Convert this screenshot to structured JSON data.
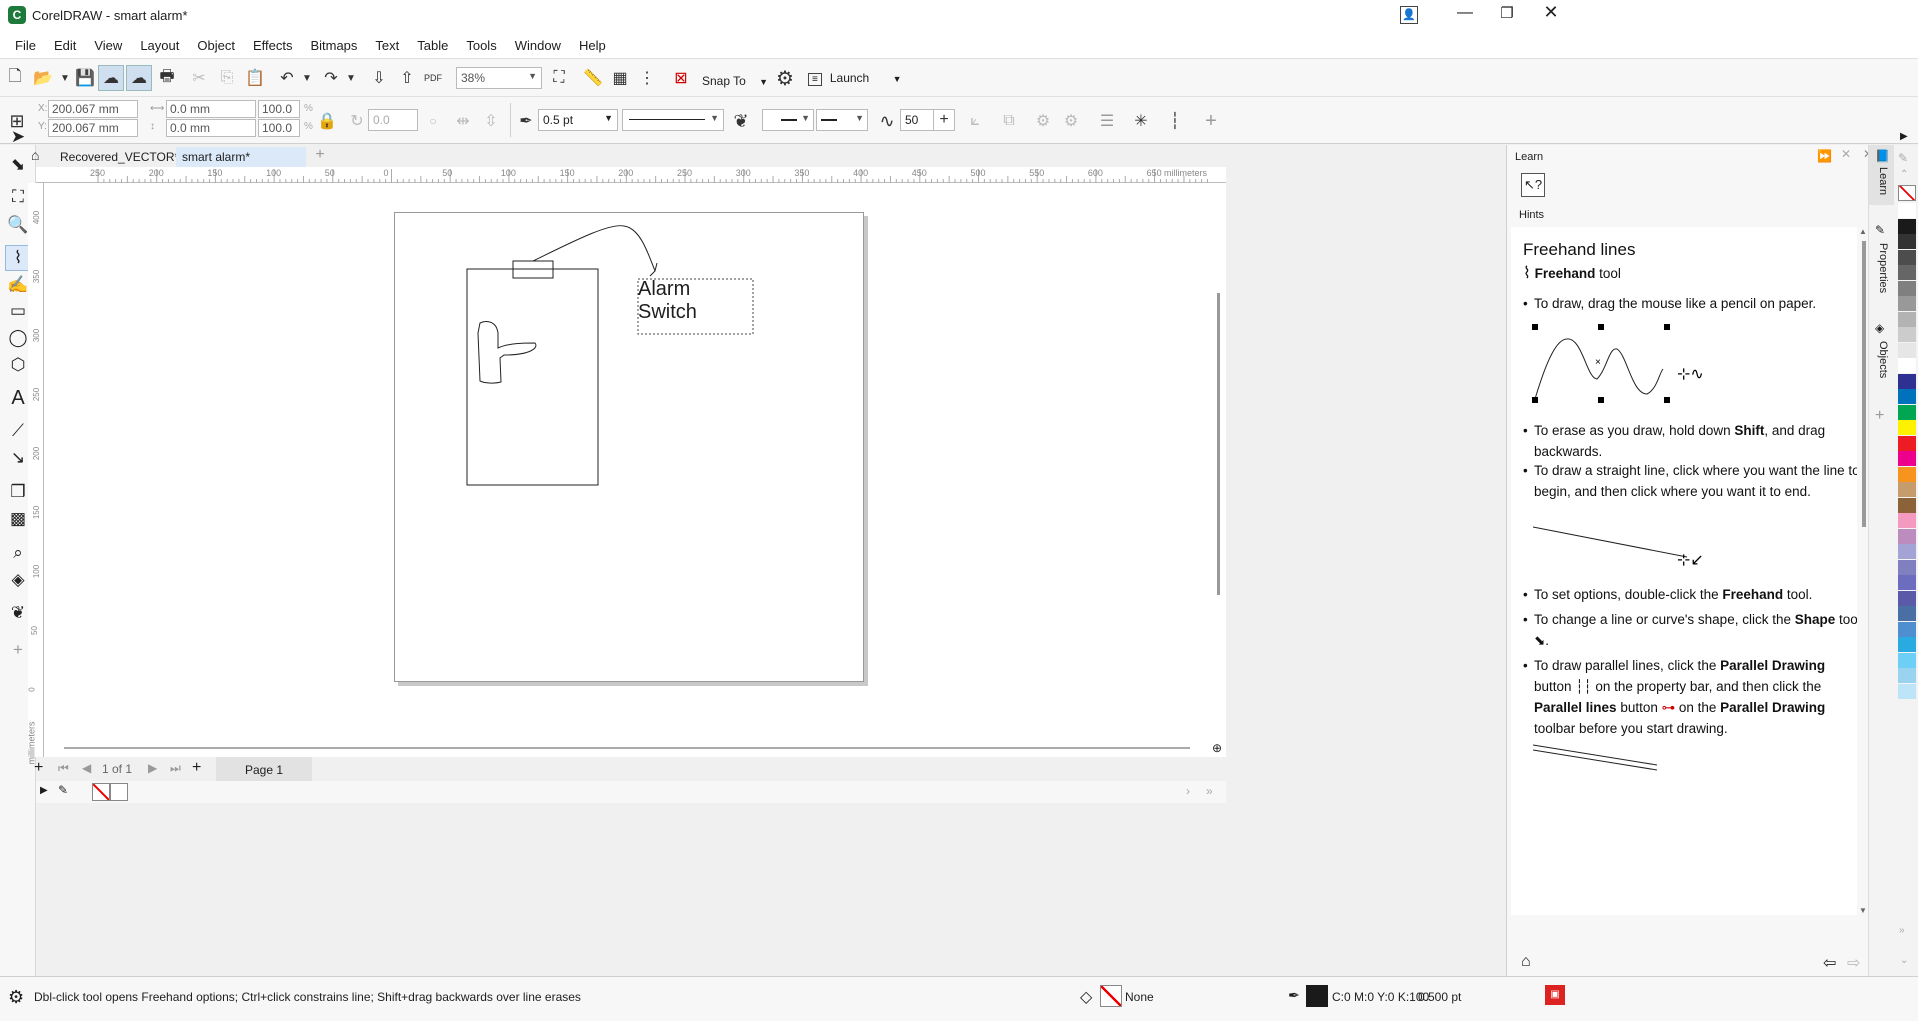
{
  "window": {
    "title": "CorelDRAW - smart alarm*"
  },
  "menu": [
    "File",
    "Edit",
    "View",
    "Layout",
    "Object",
    "Effects",
    "Bitmaps",
    "Text",
    "Table",
    "Tools",
    "Window",
    "Help"
  ],
  "stdbar": {
    "zoom": "38%",
    "snap_label": "Snap To",
    "launch_label": "Launch",
    "pdf_label": "PDF"
  },
  "propbar": {
    "x": "200.067 mm",
    "y": "200.067 mm",
    "w": "0.0 mm",
    "h": "0.0 mm",
    "sx": "100.0",
    "sy": "100.0",
    "pct": "%",
    "rotation": "0.0",
    "outline": "0.5 pt",
    "smoothing": "50",
    "x_label": "X:",
    "y_label": "Y:"
  },
  "doc_tabs": [
    {
      "label": "Recovered_VECTOR*"
    },
    {
      "label": "smart alarm*"
    }
  ],
  "rulers": {
    "h_ticks": [
      "250",
      "200",
      "150",
      "100",
      "50",
      "0",
      "50",
      "100",
      "150",
      "200",
      "250",
      "300",
      "350",
      "400",
      "450",
      "500",
      "550",
      "600",
      "650"
    ],
    "h_unit": "millimeters",
    "v_ticks": [
      "400",
      "350",
      "300",
      "250",
      "200",
      "150",
      "100",
      "50",
      "0"
    ],
    "v_unit": "millimeters"
  },
  "canvas": {
    "text_line1": "Alarm",
    "text_line2": "Switch"
  },
  "pager": {
    "counter": "1 of 1",
    "page_tab": "Page 1"
  },
  "learn": {
    "header": "Learn",
    "hints_label": "Hints",
    "title": "Freehand lines",
    "tool_name": "Freehand",
    "tool_suffix": " tool",
    "b1": "To draw, drag the mouse like a pencil on paper.",
    "b2a": "To erase as you draw, hold down ",
    "b2b": "Shift",
    "b2c": ", and drag backwards.",
    "b3": "To draw a straight line, click where you want the line to begin, and then click where you want it to end.",
    "b4a": "To set options, double-click the ",
    "b4b": "Freehand",
    "b4c": " tool.",
    "b5a": "To change a line or curve's shape, click the ",
    "b5b": "Shape",
    "b5c": " tool",
    "b6a": "To draw parallel lines, click the ",
    "b6b": "Parallel Drawing",
    "b6c": " button",
    "b6d": " on the property bar, and then click the ",
    "b6e": "Parallel lines",
    "b6f": " button ",
    "b6g": " on the ",
    "b6h": "Parallel Drawing",
    "b6i": " toolbar before you start drawing."
  },
  "docker_tabs": [
    "Learn",
    "Properties",
    "Objects"
  ],
  "palette": [
    "#ffffff",
    "#1a1a1a",
    "#333333",
    "#4d4d4d",
    "#666666",
    "#808080",
    "#999999",
    "#b3b3b3",
    "#cccccc",
    "#e6e6e6",
    "#ffffff",
    "#2e3192",
    "#0072bc",
    "#00a651",
    "#fff200",
    "#ed1c24",
    "#ec008c",
    "#f7941d",
    "#c69c6d",
    "#8c6239",
    "#f49ac1",
    "#bd8cbf",
    "#a3a3d6",
    "#8080c0",
    "#6d6dbf",
    "#5a5aa8",
    "#4a6fa5",
    "#4f8fcf",
    "#29abe2",
    "#6dcff6",
    "#9ad3f0",
    "#bde4f7"
  ],
  "status": {
    "hint": "Dbl-click tool opens Freehand options; Ctrl+click constrains line; Shift+drag backwards over line erases",
    "fill": "None",
    "color": "C:0 M:0 Y:0 K:100",
    "outline": "0.500 pt"
  },
  "colors": {
    "accent": "#1e7a3b",
    "tab_active": "#dbe9f9"
  }
}
